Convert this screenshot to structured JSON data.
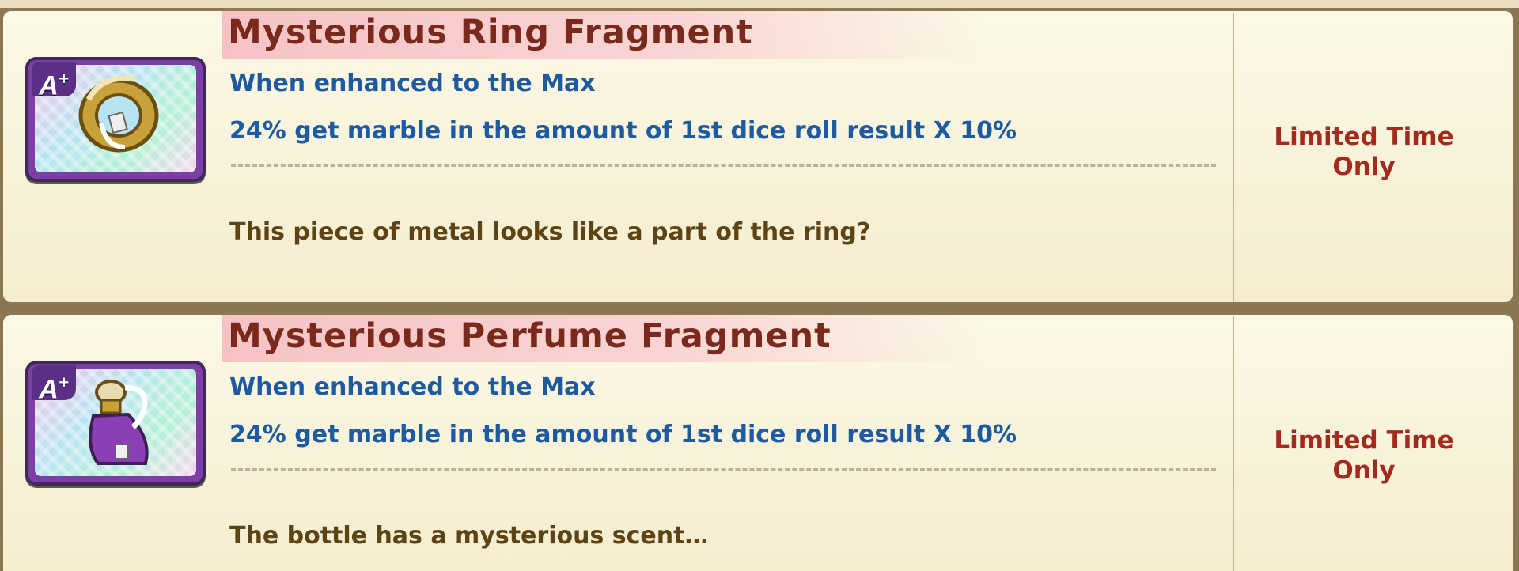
{
  "items": [
    {
      "name": "Mysterious Ring Fragment",
      "rank": "A",
      "rank_sup": "+",
      "icon": "ring-fragment-icon",
      "enhance_label": "When enhanced to the Max",
      "effect": "24% get marble in the amount of 1st dice roll result X 10%",
      "description": "This piece of metal looks like a part of the ring?",
      "availability_line1": "Limited Time",
      "availability_line2": "Only"
    },
    {
      "name": "Mysterious Perfume Fragment",
      "rank": "A",
      "rank_sup": "+",
      "icon": "perfume-fragment-icon",
      "enhance_label": "When enhanced to the Max",
      "effect": "24% get marble in the amount of 1st dice roll result X 10%",
      "description": "The bottle has a mysterious scent…",
      "availability_line1": "Limited Time",
      "availability_line2": "Only"
    }
  ],
  "colors": {
    "title": "#7a2a1c",
    "effect": "#1e5aa0",
    "description": "#5e4414",
    "limited": "#a32a1c",
    "icon_frame": "#7d3fa7"
  }
}
